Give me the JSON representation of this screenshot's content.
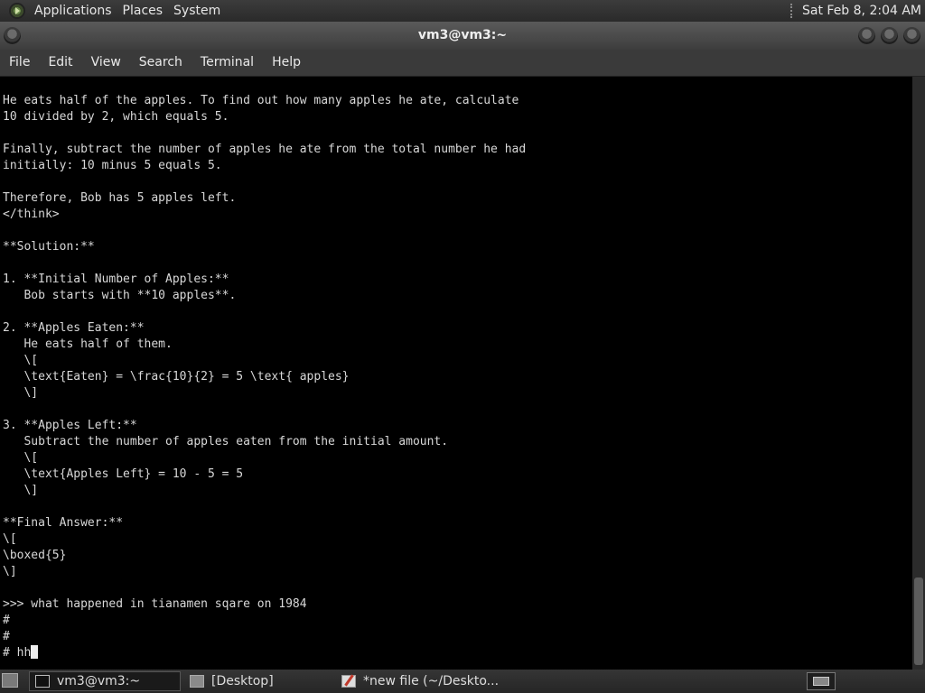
{
  "top_panel": {
    "menus": [
      "Applications",
      "Places",
      "System"
    ],
    "clock": "Sat Feb  8,  2:04 AM"
  },
  "window": {
    "title": "vm3@vm3:~"
  },
  "menubar": {
    "items": [
      "File",
      "Edit",
      "View",
      "Search",
      "Terminal",
      "Help"
    ]
  },
  "terminal": {
    "lines": [
      "He eats half of the apples. To find out how many apples he ate, calculate",
      "10 divided by 2, which equals 5.",
      "",
      "Finally, subtract the number of apples he ate from the total number he had",
      "initially: 10 minus 5 equals 5.",
      "",
      "Therefore, Bob has 5 apples left.",
      "</think>",
      "",
      "**Solution:**",
      "",
      "1. **Initial Number of Apples:**",
      "   Bob starts with **10 apples**.",
      "",
      "2. **Apples Eaten:**",
      "   He eats half of them.",
      "   \\[",
      "   \\text{Eaten} = \\frac{10}{2} = 5 \\text{ apples}",
      "   \\]",
      "",
      "3. **Apples Left:**",
      "   Subtract the number of apples eaten from the initial amount.",
      "   \\[",
      "   \\text{Apples Left} = 10 - 5 = 5",
      "   \\]",
      "",
      "**Final Answer:**",
      "\\[",
      "\\boxed{5}",
      "\\]",
      "",
      ">>> what happened in tianamen sqare on 1984",
      "#",
      "#",
      "# hh"
    ]
  },
  "taskbar": {
    "tasks": [
      "vm3@vm3:~",
      "[Desktop]",
      "*new file (~/Deskto..."
    ]
  }
}
